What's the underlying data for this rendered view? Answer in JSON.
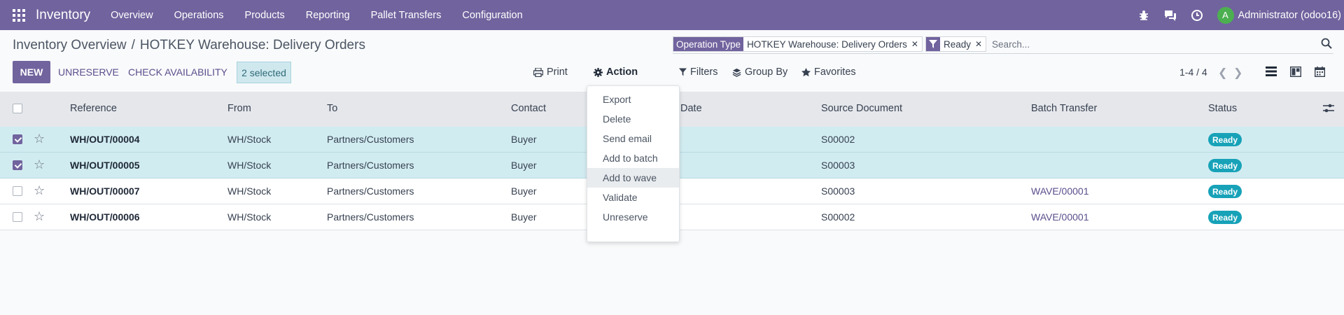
{
  "navbar": {
    "brand": "Inventory",
    "menu": [
      "Overview",
      "Operations",
      "Products",
      "Reporting",
      "Pallet Transfers",
      "Configuration"
    ],
    "user": {
      "initial": "A",
      "name": "Administrator (odoo16)"
    },
    "color": "#71639e"
  },
  "breadcrumb": {
    "parent": "Inventory Overview",
    "separator": "/",
    "current": "HOTKEY Warehouse: Delivery Orders"
  },
  "search": {
    "facets": [
      {
        "label": "Operation Type",
        "value": "HOTKEY Warehouse: Delivery Orders"
      },
      {
        "label": "filter-icon",
        "value": "Ready"
      }
    ],
    "placeholder": "Search..."
  },
  "toolbar": {
    "new_label": "NEW",
    "unreserve_label": "UNRESERVE",
    "check_label": "CHECK AVAILABILITY",
    "selected_label": "2 selected",
    "print_label": "Print",
    "action_label": "Action",
    "filters_label": "Filters",
    "groupby_label": "Group By",
    "favorites_label": "Favorites",
    "pager": "1-4 / 4"
  },
  "table": {
    "headers": {
      "reference": "Reference",
      "from": "From",
      "to": "To",
      "contact": "Contact",
      "date": "Date",
      "source": "Source Document",
      "batch": "Batch Transfer",
      "status": "Status"
    },
    "rows": [
      {
        "checked": true,
        "reference": "WH/OUT/00004",
        "from": "WH/Stock",
        "to": "Partners/Customers",
        "contact": "Buyer",
        "source": "S00002",
        "batch": "",
        "status": "Ready"
      },
      {
        "checked": true,
        "reference": "WH/OUT/00005",
        "from": "WH/Stock",
        "to": "Partners/Customers",
        "contact": "Buyer",
        "source": "S00003",
        "batch": "",
        "status": "Ready"
      },
      {
        "checked": false,
        "reference": "WH/OUT/00007",
        "from": "WH/Stock",
        "to": "Partners/Customers",
        "contact": "Buyer",
        "source": "S00003",
        "batch": "WAVE/00001",
        "status": "Ready"
      },
      {
        "checked": false,
        "reference": "WH/OUT/00006",
        "from": "WH/Stock",
        "to": "Partners/Customers",
        "contact": "Buyer",
        "source": "S00002",
        "batch": "WAVE/00001",
        "status": "Ready"
      }
    ]
  },
  "action_menu": {
    "items": [
      "Export",
      "Delete",
      "Send email",
      "Add to batch",
      "Add to wave",
      "Validate",
      "Unreserve"
    ],
    "highlighted": "Add to wave"
  }
}
